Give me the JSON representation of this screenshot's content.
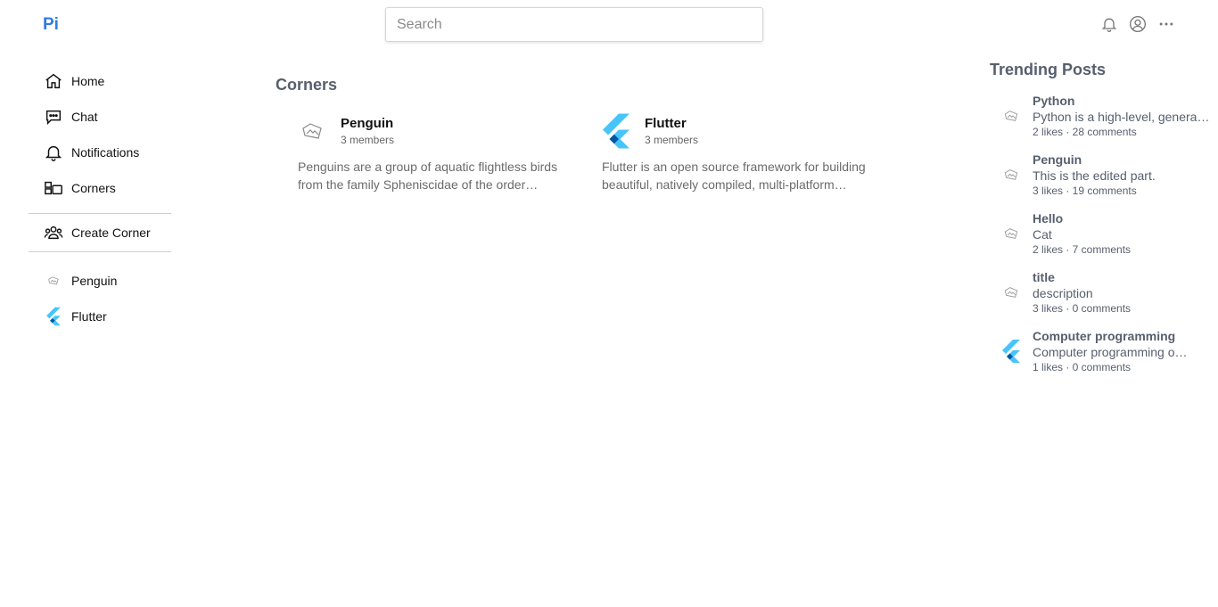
{
  "header": {
    "logo": "Pi",
    "search_placeholder": "Search",
    "icons": [
      "bell-icon",
      "account-icon",
      "more-icon"
    ]
  },
  "sidebar": {
    "nav": [
      {
        "label": "Home",
        "icon": "home-icon"
      },
      {
        "label": "Chat",
        "icon": "chat-icon"
      },
      {
        "label": "Notifications",
        "icon": "bell-icon"
      },
      {
        "label": "Corners",
        "icon": "corners-icon"
      }
    ],
    "create_corner": {
      "label": "Create Corner",
      "icon": "group-icon"
    },
    "corners": [
      {
        "label": "Penguin",
        "icon": "penguin-icon"
      },
      {
        "label": "Flutter",
        "icon": "flutter-icon"
      }
    ]
  },
  "main": {
    "title": "Corners",
    "cards": [
      {
        "name": "Penguin",
        "members": "3 members",
        "description": "Penguins are a group of aquatic flightless birds from the family Spheniscidae of the order Sphenisciformes.",
        "icon": "penguin-icon"
      },
      {
        "name": "Flutter",
        "members": "3 members",
        "description": "Flutter is an open source framework for building beautiful, natively compiled, multi-platform applications.",
        "icon": "flutter-icon"
      }
    ]
  },
  "trending": {
    "title": "Trending Posts",
    "posts": [
      {
        "title": "Python",
        "body": "Python is a high-level, general-purpose programming language.",
        "meta": "2 likes · 28 comments",
        "icon": "penguin-icon"
      },
      {
        "title": "Penguin",
        "body": "This is the edited part.",
        "meta": "3 likes · 19 comments",
        "icon": "penguin-icon"
      },
      {
        "title": "Hello",
        "body": "Cat",
        "meta": "2 likes · 7 comments",
        "icon": "penguin-icon"
      },
      {
        "title": "title",
        "body": "description",
        "meta": "3 likes · 0 comments",
        "icon": "penguin-icon"
      },
      {
        "title": "Computer programming",
        "body": "Computer programming or coding is the composition of sequences of instructions.",
        "meta": "1 likes · 0 comments",
        "icon": "flutter-icon"
      }
    ]
  },
  "colors": {
    "accent": "#2f7de1",
    "heading": "#575f6d",
    "flutter_light": "#47c5fb",
    "flutter_dark": "#0055a1"
  }
}
